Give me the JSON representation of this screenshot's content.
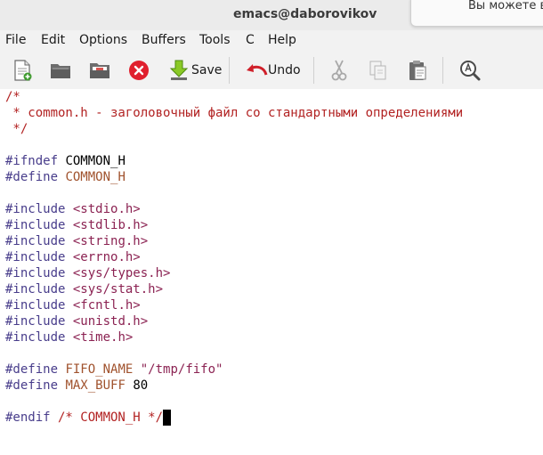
{
  "window": {
    "title": "emacs@daborovikov"
  },
  "notification": {
    "text": "Вы можете в"
  },
  "menu": [
    "File",
    "Edit",
    "Options",
    "Buffers",
    "Tools",
    "C",
    "Help"
  ],
  "toolbar": {
    "save_label": "Save",
    "undo_label": "Undo"
  },
  "code": {
    "l1": "/*",
    "l2": " * common.h - заголовочный файл со стандартными определениями",
    "l3": " */",
    "ifndef_kw": "#ifndef",
    "ifndef_name": " COMMON_H",
    "define_kw": "#define",
    "define_name": " COMMON_H",
    "include_kw": "#include",
    "includes": [
      "<stdio.h>",
      "<stdlib.h>",
      "<string.h>",
      "<errno.h>",
      "<sys/types.h>",
      "<sys/stat.h>",
      "<fcntl.h>",
      "<unistd.h>",
      "<time.h>"
    ],
    "fifo_kw": "#define",
    "fifo_name": "FIFO_NAME",
    "fifo_val": "\"/tmp/fifo\"",
    "buff_kw": "#define",
    "buff_name": "MAX_BUFF",
    "buff_val": " 80",
    "endif_kw": "#endif",
    "endif_cmt": " /* COMMON_H */"
  },
  "colors": {
    "comment": "#b22222",
    "preprocessor": "#483d8b",
    "string": "#8b2252",
    "variable": "#a0522d"
  }
}
